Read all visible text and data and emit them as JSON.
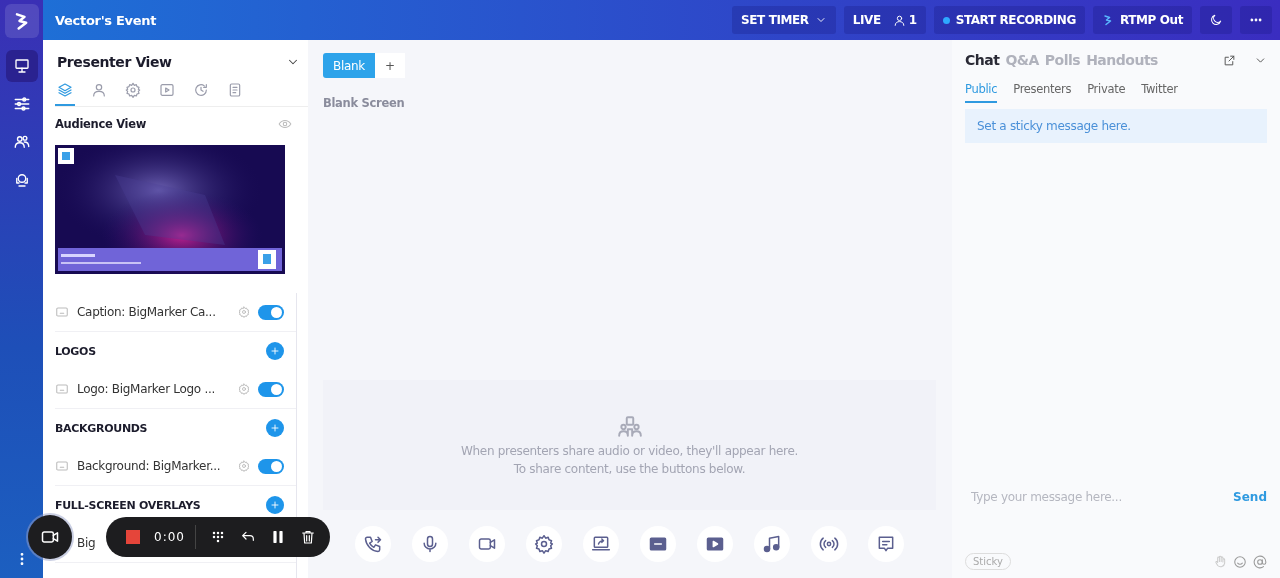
{
  "topbar": {
    "title": "Vector's Event",
    "timer": "SET TIMER",
    "live": "LIVE",
    "attendees": "1",
    "record": "START RECORDING",
    "rtmp": "RTMP Out"
  },
  "rail": {
    "items": [
      {
        "kind": "presenter",
        "selected": true
      },
      {
        "kind": "sliders",
        "selected": false
      },
      {
        "kind": "people",
        "selected": false
      },
      {
        "kind": "support",
        "selected": false
      }
    ]
  },
  "presenter_panel": {
    "title": "Presenter View",
    "tabs": [
      {
        "kind": "layers",
        "selected": true
      },
      {
        "kind": "person",
        "selected": false
      },
      {
        "kind": "gear",
        "selected": false
      },
      {
        "kind": "play",
        "selected": false
      },
      {
        "kind": "history",
        "selected": false
      },
      {
        "kind": "doc",
        "selected": false
      }
    ],
    "audience_view": {
      "title": "Audience View"
    },
    "layers": [
      {
        "kind": "item",
        "label": "Caption: BigMarker Ca...",
        "on": true
      },
      {
        "kind": "section",
        "label": "LOGOS"
      },
      {
        "kind": "item",
        "label": "Logo: BigMarker Logo ...",
        "on": true
      },
      {
        "kind": "section",
        "label": "BACKGROUNDS"
      },
      {
        "kind": "item",
        "label": "Background: BigMarker...",
        "on": true
      },
      {
        "kind": "section",
        "label": "FULL-SCREEN OVERLAYS"
      },
      {
        "kind": "item",
        "label": "Big"
      }
    ]
  },
  "recorder": {
    "time": "0:00"
  },
  "stage": {
    "scenes": [
      {
        "label": "Blank",
        "selected": true
      },
      {
        "label": "+",
        "selected": false
      }
    ],
    "scene_title": "Blank Screen",
    "empty_lines": [
      "When presenters share audio or video, they'll appear here.",
      "To share content, use the buttons below."
    ],
    "tools": [
      {
        "kind": "phone"
      },
      {
        "kind": "mic"
      },
      {
        "kind": "camera"
      },
      {
        "kind": "gear"
      },
      {
        "kind": "screen"
      },
      {
        "kind": "caption"
      },
      {
        "kind": "video"
      },
      {
        "kind": "music"
      },
      {
        "kind": "broadcast"
      },
      {
        "kind": "note"
      }
    ]
  },
  "chat": {
    "tabs": [
      {
        "label": "Chat",
        "selected": true
      },
      {
        "label": "Q&A",
        "selected": false
      },
      {
        "label": "Polls",
        "selected": false
      },
      {
        "label": "Handouts",
        "selected": false
      }
    ],
    "subtabs": [
      {
        "label": "Public",
        "selected": true
      },
      {
        "label": "Presenters",
        "selected": false
      },
      {
        "label": "Private",
        "selected": false
      },
      {
        "label": "Twitter",
        "selected": false
      }
    ],
    "sticky_message": "Set a sticky message here.",
    "input": {
      "placeholder": "Type your message here..."
    },
    "send": "Send",
    "sticky_button": "Sticky"
  }
}
